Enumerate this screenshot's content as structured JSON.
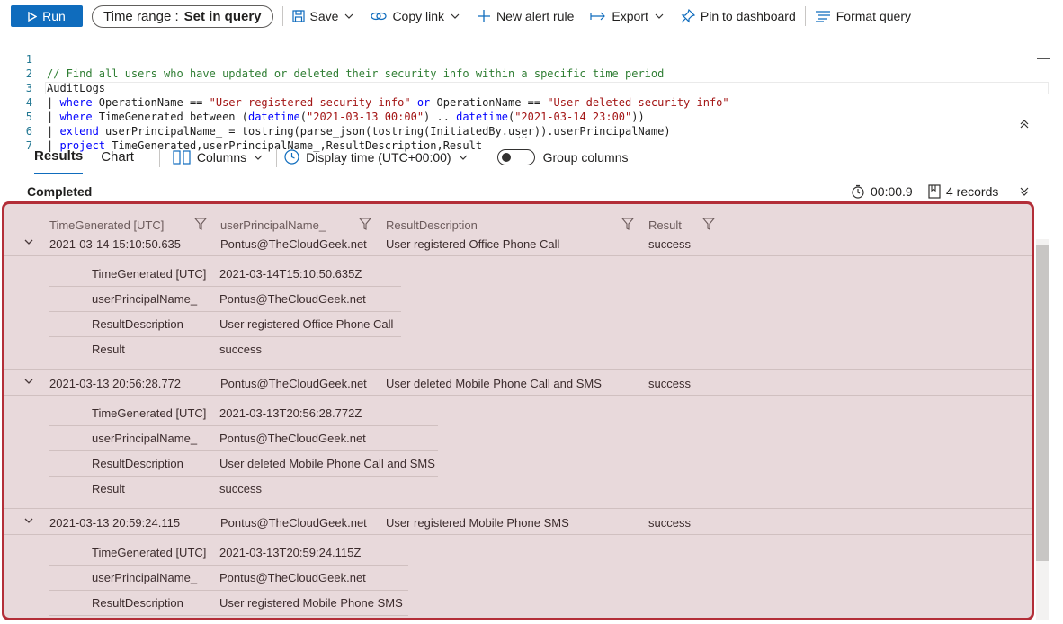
{
  "toolbar": {
    "run_label": "Run",
    "time_range_label": "Time range :",
    "time_range_value": "Set in query",
    "save_label": "Save",
    "copy_link_label": "Copy link",
    "new_alert_label": "New alert rule",
    "export_label": "Export",
    "pin_label": "Pin to dashboard",
    "format_label": "Format query"
  },
  "editor": {
    "line_numbers": [
      "1",
      "2",
      "3",
      "4",
      "5",
      "6",
      "7"
    ],
    "l1_comment": "// Find all users who have updated or deleted their security info within a specific time period",
    "l2_table": "AuditLogs",
    "l3": {
      "pipe": "| ",
      "kw": "where",
      "a": " OperationName == ",
      "s1": "\"User registered security info\"",
      "or": " or ",
      "b": "OperationName == ",
      "s2": "\"User deleted security info\""
    },
    "l4": {
      "pipe": "| ",
      "kw": "where",
      "a": " TimeGenerated between (",
      "fn1": "datetime",
      "p1": "(",
      "s1": "\"2021-03-13 00:00\"",
      "p2": ") .. ",
      "fn2": "datetime",
      "p3": "(",
      "s2": "\"2021-03-14 23:00\"",
      "p4": "))"
    },
    "l5": {
      "pipe": "| ",
      "kw": "extend",
      "a": " userPrincipalName_ = tostring(parse_json(tostring(InitiatedBy.user)).userPrincipalName)"
    },
    "l6": {
      "pipe": "| ",
      "kw": "project",
      "a": " TimeGenerated,userPrincipalName_,ResultDescription,Result"
    },
    "dots": "..."
  },
  "results_bar": {
    "tab_results": "Results",
    "tab_chart": "Chart",
    "columns_label": "Columns",
    "display_time_label": "Display time (UTC+00:00)",
    "group_columns_label": "Group columns"
  },
  "status": {
    "completed": "Completed",
    "duration": "00:00.9",
    "records": "4 records"
  },
  "grid": {
    "headers": [
      "TimeGenerated [UTC]",
      "userPrincipalName_",
      "ResultDescription",
      "Result"
    ],
    "rows": [
      {
        "time": "2021-03-14 15:10:50.635",
        "user": "Pontus@TheCloudGeek.net",
        "desc": "User registered Office Phone Call",
        "result": "success",
        "details": [
          {
            "label": "TimeGenerated [UTC]",
            "value": "2021-03-14T15:10:50.635Z"
          },
          {
            "label": "userPrincipalName_",
            "value": "Pontus@TheCloudGeek.net"
          },
          {
            "label": "ResultDescription",
            "value": "User registered Office Phone Call"
          },
          {
            "label": "Result",
            "value": "success"
          }
        ]
      },
      {
        "time": "2021-03-13 20:56:28.772",
        "user": "Pontus@TheCloudGeek.net",
        "desc": "User deleted Mobile Phone Call and SMS",
        "result": "success",
        "details": [
          {
            "label": "TimeGenerated [UTC]",
            "value": "2021-03-13T20:56:28.772Z"
          },
          {
            "label": "userPrincipalName_",
            "value": "Pontus@TheCloudGeek.net"
          },
          {
            "label": "ResultDescription",
            "value": "User deleted Mobile Phone Call and SMS"
          },
          {
            "label": "Result",
            "value": "success"
          }
        ]
      },
      {
        "time": "2021-03-13 20:59:24.115",
        "user": "Pontus@TheCloudGeek.net",
        "desc": "User registered Mobile Phone SMS",
        "result": "success",
        "details": [
          {
            "label": "TimeGenerated [UTC]",
            "value": "2021-03-13T20:59:24.115Z"
          },
          {
            "label": "userPrincipalName_",
            "value": "Pontus@TheCloudGeek.net"
          },
          {
            "label": "ResultDescription",
            "value": "User registered Mobile Phone SMS"
          }
        ]
      }
    ]
  },
  "colors": {
    "accent": "#0f6cbd",
    "highlight_border": "#b32e38"
  }
}
